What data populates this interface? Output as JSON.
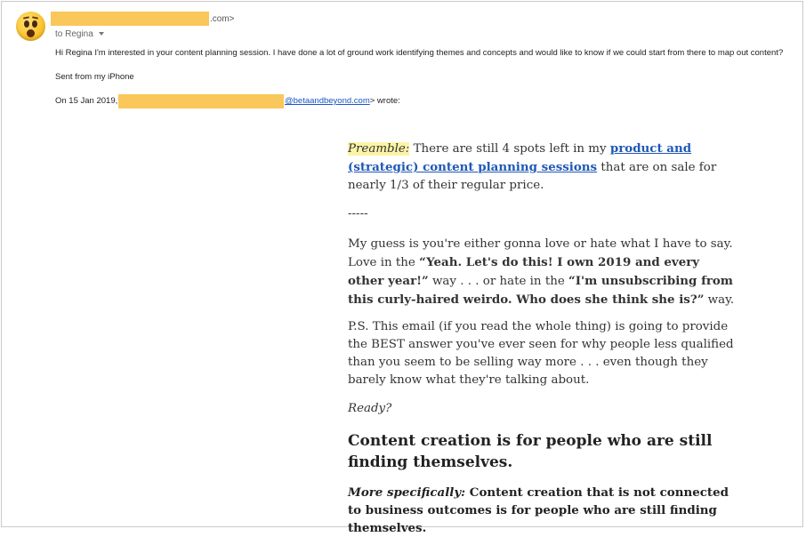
{
  "header": {
    "sender_suffix": ".com>",
    "to_label": "to Regina"
  },
  "message": {
    "body": "Hi Regina I'm interested in your content planning session. I have done a lot of ground  work identifying themes and concepts and would like to know if we could start from there to map out content?",
    "signature": "Sent from my iPhone",
    "quote_intro_date": "On 15 Jan 2019,",
    "quote_intro_link": "@betaandbeyond.com",
    "quote_intro_end": "> wrote:"
  },
  "quoted": {
    "preamble_label": "Preamble:",
    "preamble_text_1": " There are still 4 spots left in my ",
    "preamble_link": "product and (strategic) content planning sessions",
    "preamble_text_2": " that are on sale for nearly 1/3 of their regular price.",
    "separator": "-----",
    "guess_1": "My guess is you're either gonna love or hate what I have to say. Love in the ",
    "guess_bold_1": "“Yeah. Let's do this! I own 2019 and every other year!”",
    "guess_2": " way . . . or hate in the ",
    "guess_bold_2": "“I'm unsubscribing from this curly-haired weirdo. Who does she think she is?”",
    "guess_3": " way.",
    "ps": "P.S. This email (if you read the whole thing) is going to provide the BEST answer you've ever seen for why people less qualified than you seem to be selling way more . . . even though they barely know what they're talking about.",
    "ready": "Ready?",
    "heading": "Content creation is for people who are still finding themselves.",
    "spec_label": "More specifically:",
    "spec_text": " Content creation that is not connected to business outcomes is for people who are still finding themselves."
  },
  "colors": {
    "redaction": "#f9c75a",
    "link": "#1f58b5",
    "highlight": "#fbf4a6"
  },
  "icons": {
    "avatar": "surprised-face-emoji-icon",
    "to_dropdown": "caret-down-icon"
  }
}
